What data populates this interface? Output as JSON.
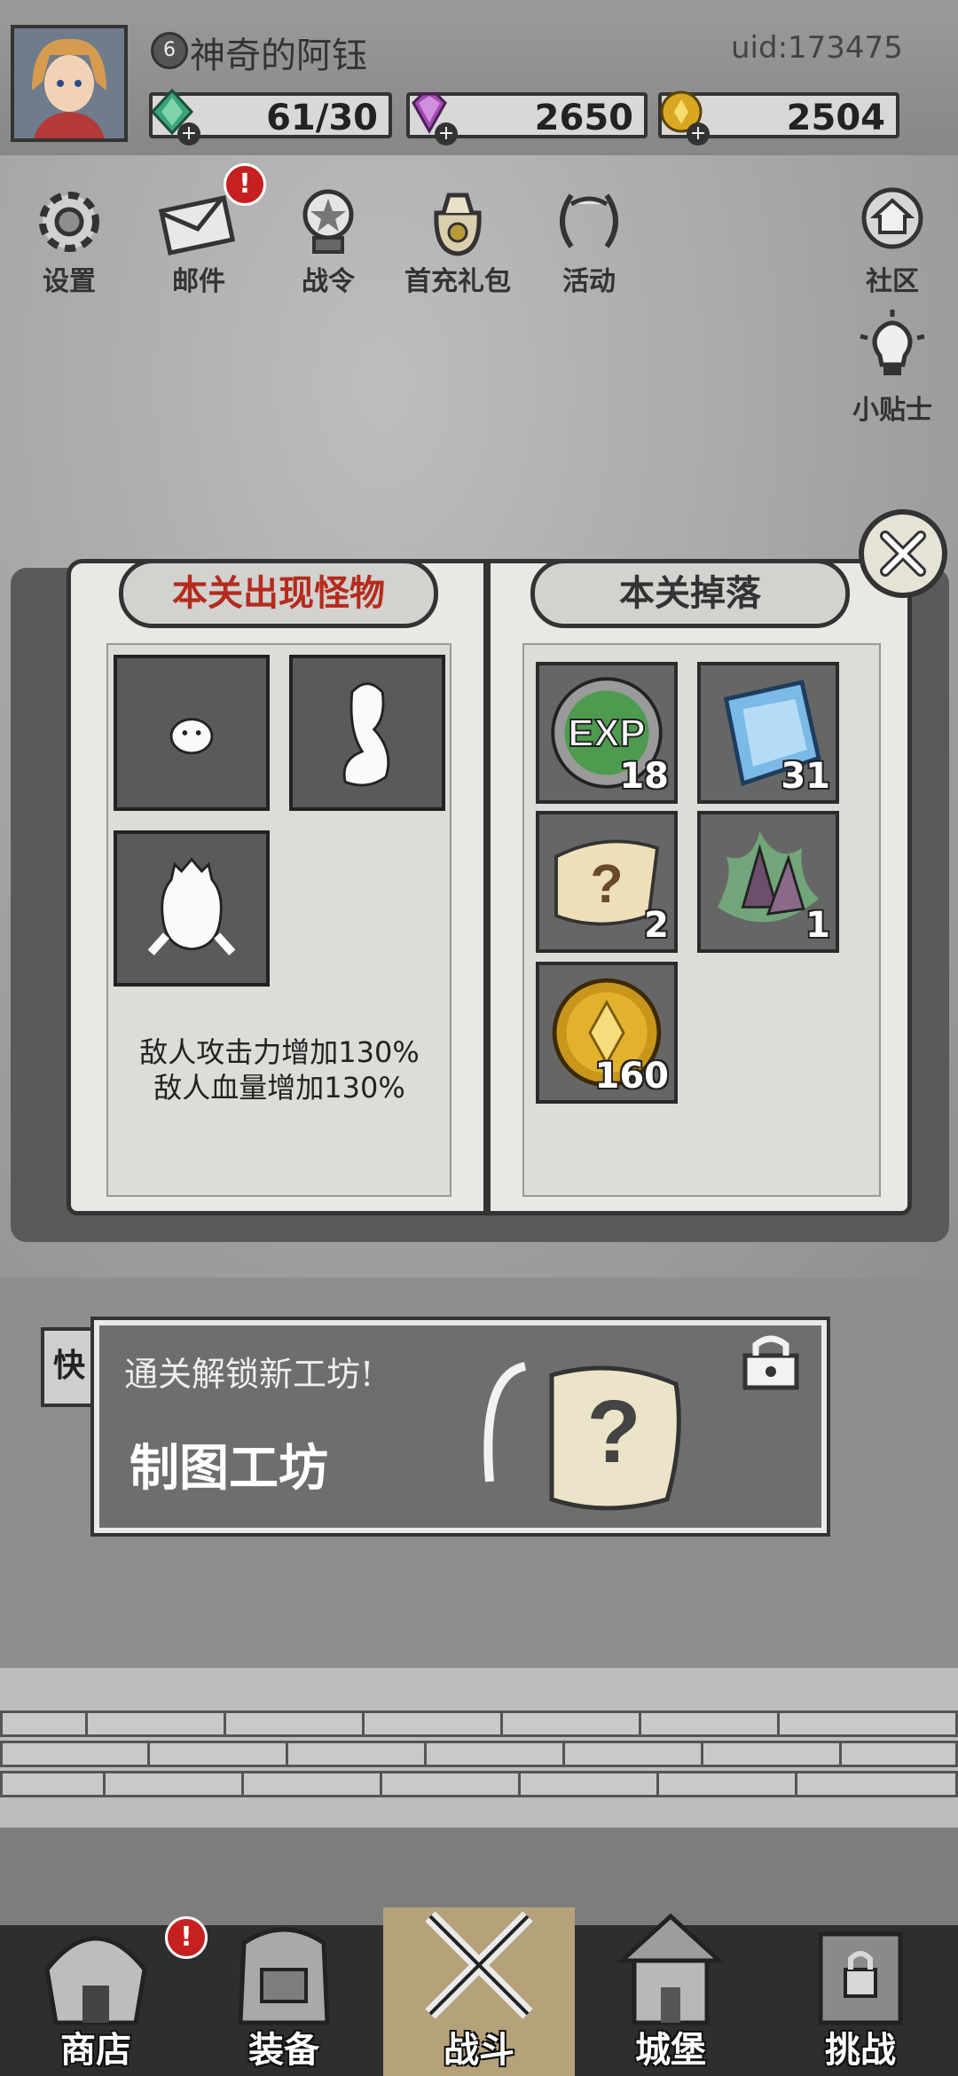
{
  "header": {
    "player_name": "神奇的阿钰",
    "level": "6",
    "uid": "uid:173475",
    "resources": [
      {
        "name": "stamina",
        "value": "61/30",
        "color": "#3aa37a"
      },
      {
        "name": "gems",
        "value": "2650",
        "color": "#a24bb3"
      },
      {
        "name": "coins",
        "value": "2504",
        "color": "#d8a823"
      }
    ]
  },
  "top_buttons": [
    {
      "label": "设置",
      "icon": "gear-icon"
    },
    {
      "label": "邮件",
      "icon": "mail-icon",
      "badge": "!"
    },
    {
      "label": "战令",
      "icon": "battle-pass-icon"
    },
    {
      "label": "首充礼包",
      "icon": "gift-bag-icon"
    },
    {
      "label": "活动",
      "icon": "laurel-icon"
    },
    {
      "label": "社区",
      "icon": "home-icon"
    },
    {
      "label": "小贴士",
      "icon": "lightbulb-icon"
    }
  ],
  "book": {
    "left_title": "本关出现怪物",
    "right_title": "本关掉落",
    "modifiers": [
      "敌人攻击力增加130%",
      "敌人血量增加130%"
    ],
    "drops": [
      {
        "item": "exp",
        "label": "EXP",
        "count": "18"
      },
      {
        "item": "blue-gem",
        "count": "31"
      },
      {
        "item": "mystery-scroll",
        "count": "2"
      },
      {
        "item": "purple-crystal",
        "count": "1"
      },
      {
        "item": "gold-coin",
        "count": "160"
      }
    ]
  },
  "unlock_banner": {
    "title": "通关解锁新工坊!",
    "name": "制图工坊",
    "side_tab": "快"
  },
  "nav": [
    {
      "label": "商店",
      "badge": "!"
    },
    {
      "label": "装备"
    },
    {
      "label": "战斗",
      "active": true
    },
    {
      "label": "城堡"
    },
    {
      "label": "挑战"
    }
  ]
}
